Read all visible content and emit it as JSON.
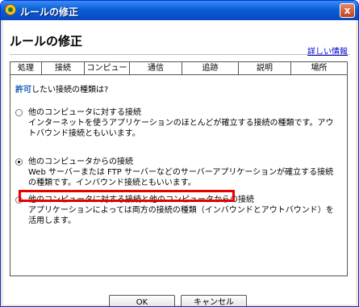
{
  "window": {
    "title": "ルールの修正",
    "close_label": "x"
  },
  "header": {
    "title": "ルールの修正",
    "help_link": "詳しい情報"
  },
  "tabs": [
    "処理",
    "接続",
    "コンピュータ",
    "通信",
    "追跡",
    "説明",
    "場所"
  ],
  "active_tab": "接続",
  "panel": {
    "question_highlight": "許可",
    "question_rest": "したい接続の種類は?",
    "options": [
      {
        "label": "他のコンピュータに対する接続",
        "desc": "インターネットを使うアプリケーションのほとんどが確立する接続の種類です。アウトバウンド接続ともいいます。",
        "selected": false
      },
      {
        "label": "他のコンピュータからの接続",
        "desc": "Web サーバーまたは FTP サーバーなどのサーバーアプリケーションが確立する接続の種類です。インバウンド接続ともいいます。",
        "selected": true
      },
      {
        "label": "他のコンピュータに対する接続と他のコンピュータからの接続",
        "desc": "アプリケーションによっては両方の接続の種類（インバウンドとアウトバウンド）を活用します。",
        "selected": false
      }
    ]
  },
  "buttons": {
    "ok": "OK",
    "cancel": "キャンセル"
  },
  "colors": {
    "highlight_box": "#e60000",
    "link": "#0000cc",
    "titlebar": "#0a5fd6"
  }
}
